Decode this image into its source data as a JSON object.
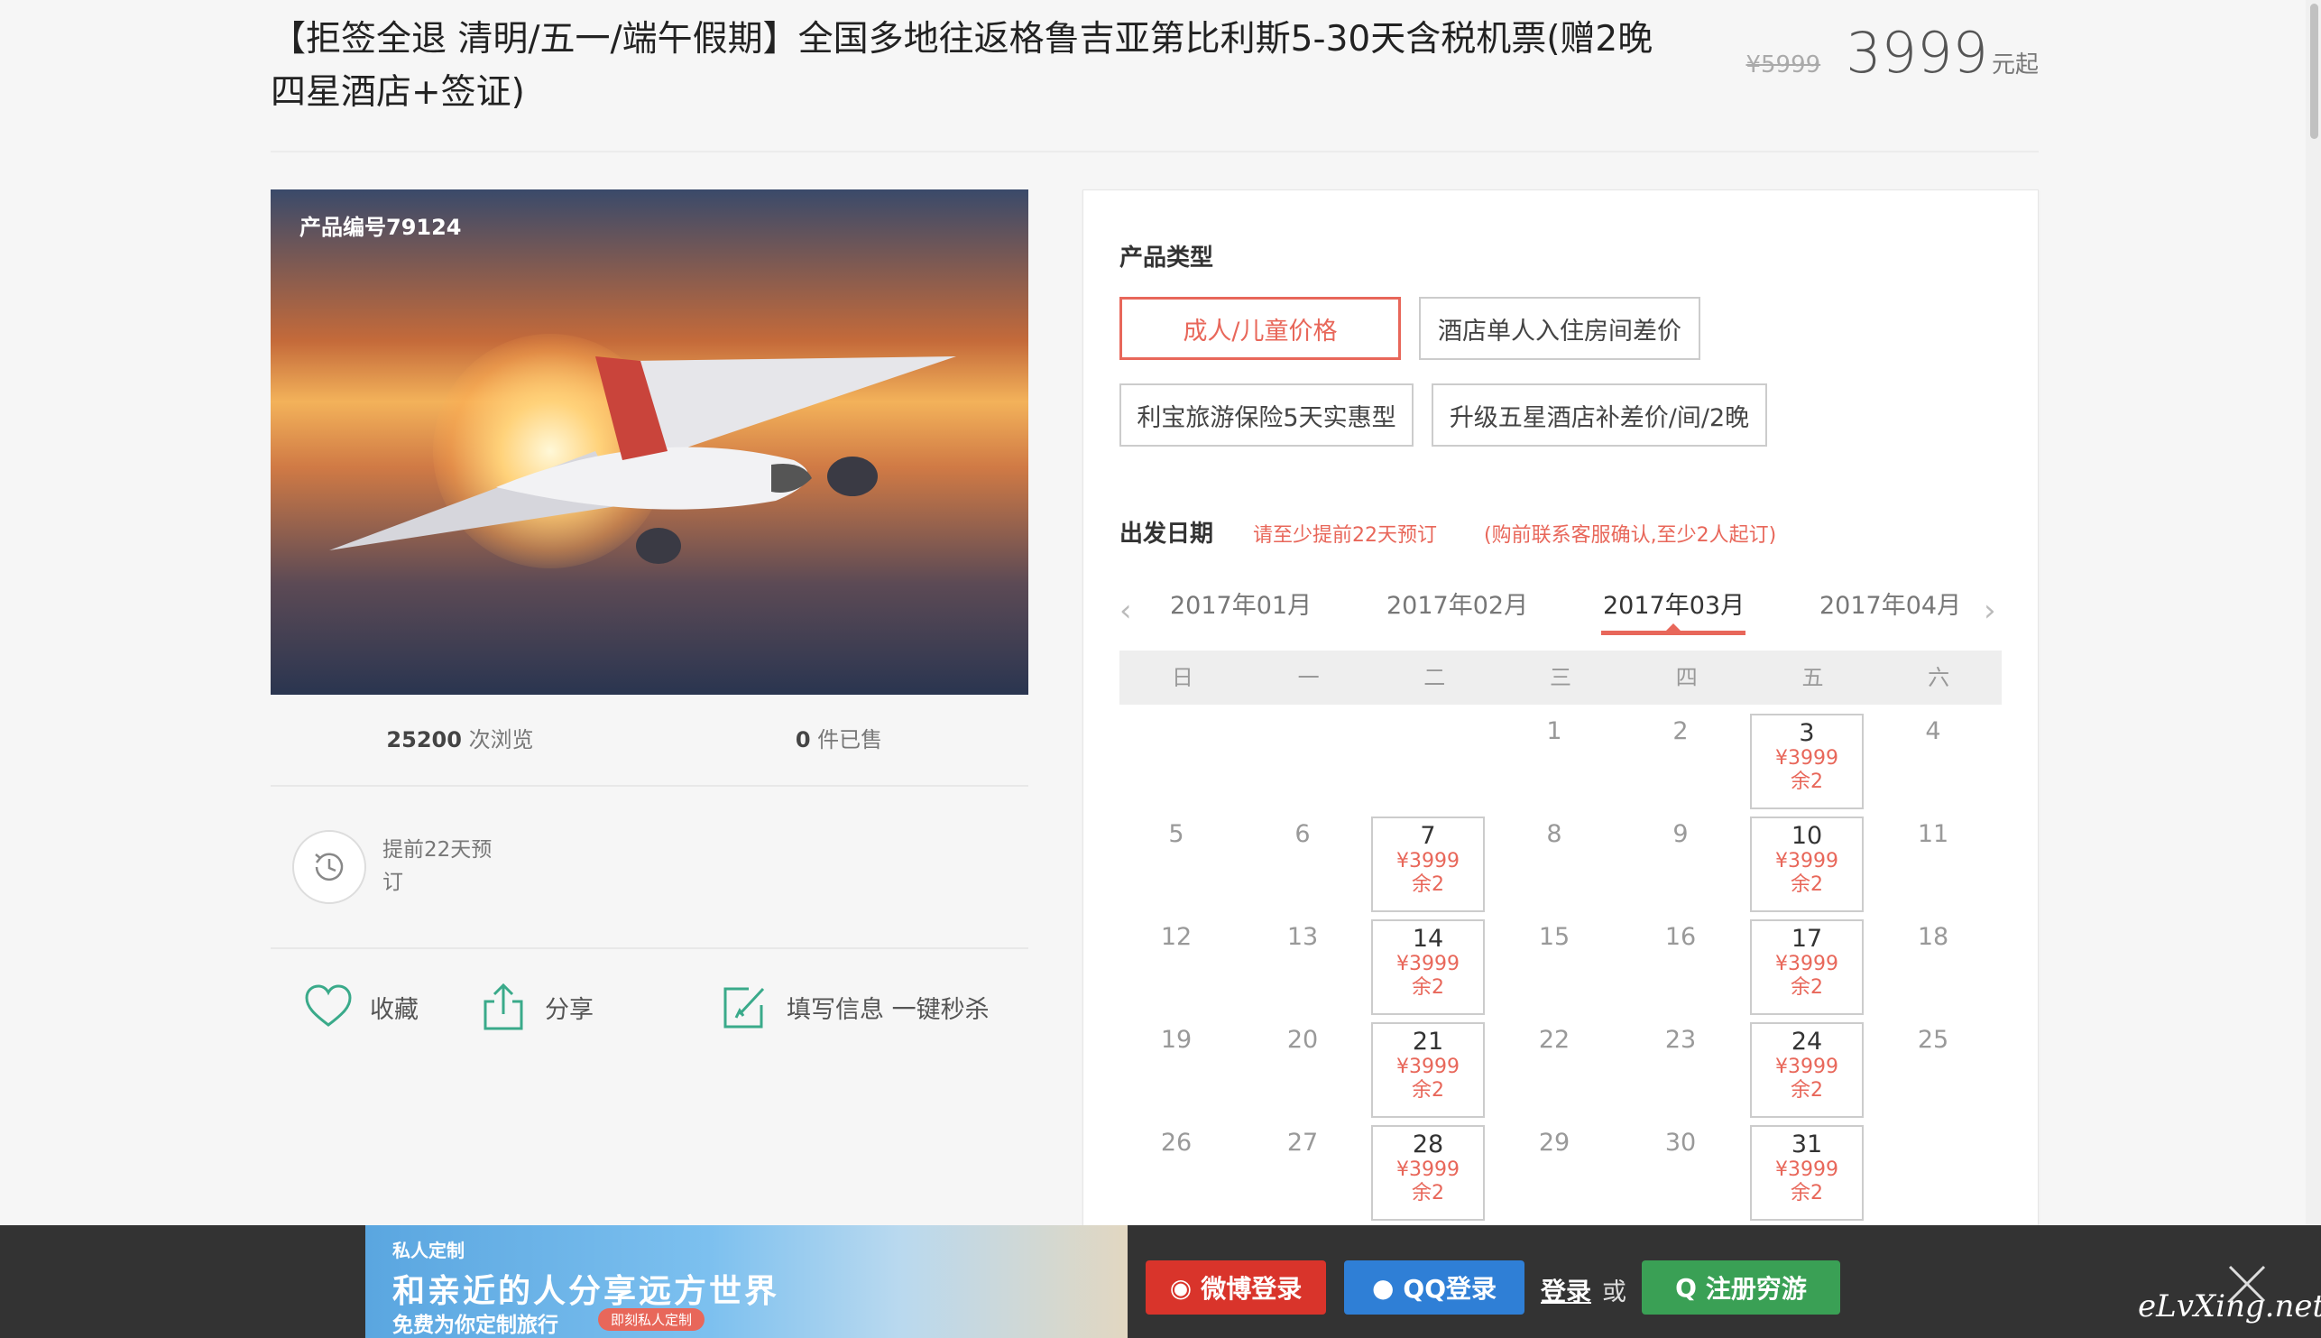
{
  "product": {
    "title": "【拒签全退 清明/五一/端午假期】全国多地往返格鲁吉亚第比利斯5-30天含税机票(赠2晚四星酒店+签证)",
    "old_price": "¥5999",
    "price": "3999",
    "price_unit": "元起",
    "product_id": "产品编号79124",
    "views_count": "25200",
    "views_label": "次浏览",
    "sold_count": "0",
    "sold_label": "件已售",
    "advance_text": "提前22天预订"
  },
  "actions": {
    "favorite": "收藏",
    "share": "分享",
    "fill_info": "填写信息 一键秒杀"
  },
  "booking": {
    "type_label": "产品类型",
    "types": [
      "成人/儿童价格",
      "酒店单人入住房间差价",
      "利宝旅游保险5天实惠型",
      "升级五星酒店补差价/间/2晚"
    ],
    "date_label": "出发日期",
    "hint1": "请至少提前22天预订",
    "hint2": "(购前联系客服确认,至少2人起订)",
    "months": [
      "2017年01月",
      "2017年02月",
      "2017年03月",
      "2017年04月"
    ],
    "weekdays": [
      "日",
      "一",
      "二",
      "三",
      "四",
      "五",
      "六"
    ],
    "price_label": "¥3999",
    "stock_label": "余2"
  },
  "footer": {
    "banner_tag": "私人定制",
    "banner_headline": "和亲近的人分享远方世界",
    "banner_sub": "免费为你定制旅行",
    "banner_button": "即刻私人定制",
    "weibo_login": "微博登录",
    "qq_login": "QQ登录",
    "login": "登录",
    "or": "或",
    "register": "注册穷游",
    "watermark": "eLvXing.net"
  },
  "colors": {
    "accent": "#e8675a",
    "green_icon": "#3aaa8a",
    "weibo": "#d9342b",
    "qq": "#2f7fd6",
    "register": "#3aa055"
  }
}
